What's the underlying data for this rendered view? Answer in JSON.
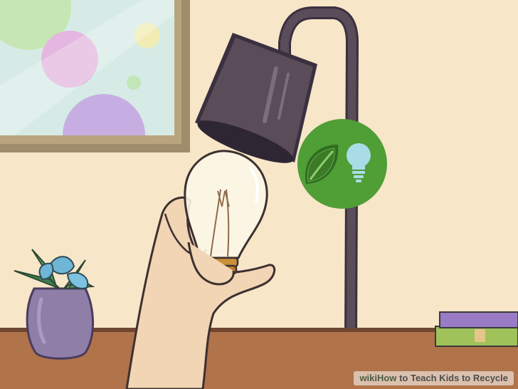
{
  "colors": {
    "wall": "#f7e6c8",
    "desk": "#b0734a",
    "lamp": "#5a4c58",
    "badge_green": "#4f9e36",
    "leaf": "#3c7a28",
    "bulb_icon": "#a9dce6",
    "skin": "#f1d5b4",
    "bulb_base": "#c9913a",
    "frame": "#9f8c6a",
    "vase": "#8f7fa8",
    "book_purple": "#9a7bc6",
    "book_green": "#9fc25a"
  },
  "icons": {
    "badge": "leaf-and-lightbulb-icon"
  },
  "watermark": {
    "prefix": "wiki",
    "how": "How",
    "title": " to Teach Kids to Recycle"
  }
}
